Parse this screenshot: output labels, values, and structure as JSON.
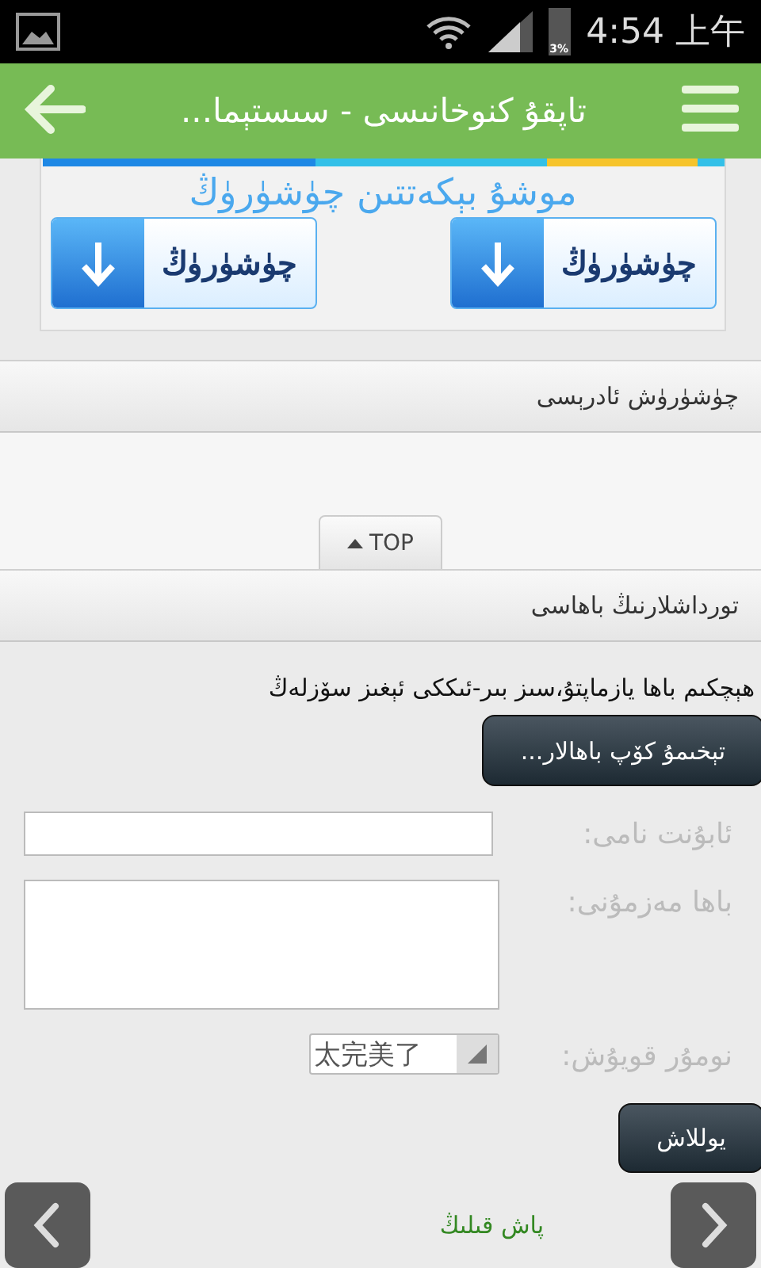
{
  "status_bar": {
    "battery": "3%",
    "time": "4:54 上午"
  },
  "header": {
    "title": "تاپقۇ كنوخانىسى - سىستېما..."
  },
  "banner": {
    "title": "موشۇ بېكەتتىن چۈشۈرۈڭ",
    "buttons": [
      {
        "label": "چۈشۈرۈڭ"
      },
      {
        "label": "چۈشۈرۈڭ"
      }
    ]
  },
  "sections": [
    {
      "title": "چۈشۈرۈش ئادرېسى"
    },
    {
      "title": "تورداشلارنىڭ باھاسى"
    }
  ],
  "top_button": {
    "label": "TOP"
  },
  "comments": {
    "notice": "ھېچكىم باھا يازماپتۇ،سىز بىر-ئىككى ئېغىز سۆزلەڭ",
    "more_button": "تېخىمۇ كۆپ باھالار...",
    "fields": [
      {
        "kind": "input",
        "label": "ئابۇنت نامى:"
      },
      {
        "kind": "textarea",
        "label": "باھا مەزمۇنى:"
      },
      {
        "kind": "select",
        "label": "نومۇر قويۇش:",
        "value": "太完美了"
      }
    ],
    "submit": "يوللاش",
    "hint": "پاش قىلىڭ"
  }
}
